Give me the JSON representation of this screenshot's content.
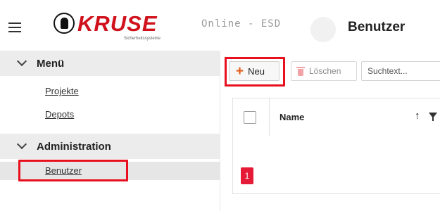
{
  "header": {
    "brand": "KRUSE",
    "tagline": "Sicherheitssysteme",
    "subtitle": "Online - ESD",
    "page_title": "Benutzer"
  },
  "sidebar": {
    "groups": [
      {
        "label": "Menü",
        "items": [
          {
            "label": "Projekte"
          },
          {
            "label": "Depots"
          }
        ]
      },
      {
        "label": "Administration",
        "items": [
          {
            "label": "Benutzer",
            "active": true
          }
        ]
      }
    ]
  },
  "toolbar": {
    "new_label": "Neu",
    "delete_label": "Löschen",
    "search_placeholder": "Suchtext..."
  },
  "table": {
    "columns": [
      {
        "label": "Name"
      }
    ],
    "rows": []
  },
  "pagination": {
    "current_page": "1"
  },
  "colors": {
    "brand_red": "#d0121c",
    "highlight": "#e8101e",
    "page_active": "#e51a36",
    "add_icon": "#e35a1a"
  },
  "icons": [
    "menu-icon",
    "kruse-logo",
    "chevron-down-icon",
    "plus-icon",
    "trash-icon",
    "sort-ascending-icon",
    "filter-icon"
  ]
}
